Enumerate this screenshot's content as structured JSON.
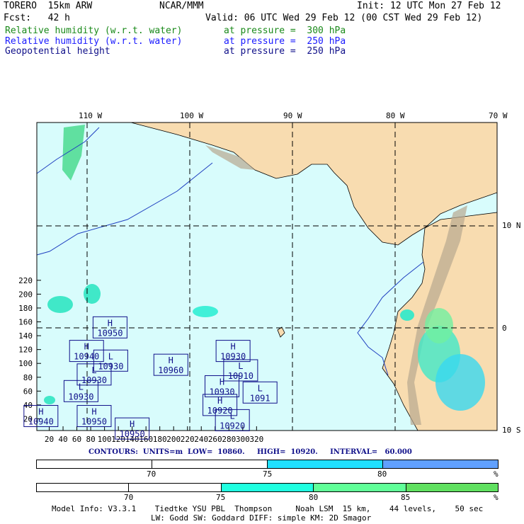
{
  "header": {
    "model": "TORERO  15km ARW",
    "org": "NCAR/MMM",
    "init": "Init: 12 UTC Mon 27 Feb 12",
    "fcst": "Fcst:   42 h",
    "valid": "Valid: 06 UTC Wed 29 Feb 12 (00 CST Wed 29 Feb 12)",
    "fields": [
      {
        "name": "Relative humidity (w.r.t. water)",
        "level": "at pressure =  300 hPa",
        "color": "#1a8a1a"
      },
      {
        "name": "Relative humidity (w.r.t. water)",
        "level": "at pressure =  250 hPa",
        "color": "#1a1aff"
      },
      {
        "name": "Geopotential height",
        "level": "at pressure =  250 hPa",
        "color": "#10108a"
      }
    ]
  },
  "map": {
    "lon_labels": [
      "110 W",
      "100 W",
      "90 W",
      "80 W",
      "70 W"
    ],
    "lat_labels": [
      "10 N",
      "0",
      "10 S"
    ],
    "x_ticks": [
      "20",
      "40",
      "60",
      "80",
      "100",
      "120",
      "140",
      "160",
      "180",
      "200",
      "220",
      "240",
      "260",
      "280",
      "300",
      "320"
    ],
    "y_ticks": [
      "20",
      "40",
      "60",
      "80",
      "100",
      "120",
      "140",
      "160",
      "180",
      "200",
      "220"
    ],
    "centers": [
      {
        "type": "H",
        "value": "10950",
        "gx": 108,
        "gy": 152
      },
      {
        "type": "H",
        "value": "10940",
        "gx": 74,
        "gy": 118
      },
      {
        "type": "L",
        "value": "10930",
        "gx": 109,
        "gy": 104
      },
      {
        "type": "L",
        "value": "10930",
        "gx": 85,
        "gy": 84
      },
      {
        "type": "L",
        "value": "10930",
        "gx": 66,
        "gy": 60
      },
      {
        "type": "H",
        "value": "10960",
        "gx": 196,
        "gy": 98
      },
      {
        "type": "H",
        "value": "10940",
        "gx": 8,
        "gy": 24
      },
      {
        "type": "H",
        "value": "10950",
        "gx": 85,
        "gy": 24
      },
      {
        "type": "H",
        "value": "10950",
        "gx": 140,
        "gy": 6
      },
      {
        "type": "H",
        "value": "10930",
        "gx": 286,
        "gy": 118
      },
      {
        "type": "L",
        "value": "10910",
        "gx": 297,
        "gy": 90
      },
      {
        "type": "H",
        "value": "10930",
        "gx": 270,
        "gy": 67
      },
      {
        "type": "L",
        "value": "1091",
        "gx": 325,
        "gy": 58
      },
      {
        "type": "H",
        "value": "10920",
        "gx": 267,
        "gy": 40
      },
      {
        "type": "L",
        "value": "10920",
        "gx": 285,
        "gy": 18
      }
    ]
  },
  "contour_info": "CONTOURS:  UNITS=m  LOW=  10860.     HIGH=  10920.     INTERVAL=   60.000",
  "colorbar1": {
    "labels": [
      "70",
      "75",
      "80",
      "%"
    ],
    "colors": [
      "#ffffff",
      "#ffffff",
      "#20e0ff",
      "#60a0ff"
    ]
  },
  "colorbar2": {
    "labels": [
      "70",
      "75",
      "80",
      "85",
      "%"
    ],
    "colors": [
      "#ffffff",
      "#ffffff",
      "#20ffe0",
      "#60ff98",
      "#60e060"
    ]
  },
  "footer": {
    "line1": "Model Info: V3.3.1    Tiedtke YSU PBL  Thompson     Noah LSM  15 km,    44 levels,    50 sec",
    "line2": "LW: Godd SW: Goddard DIFF: simple KM: 2D Smagor"
  }
}
